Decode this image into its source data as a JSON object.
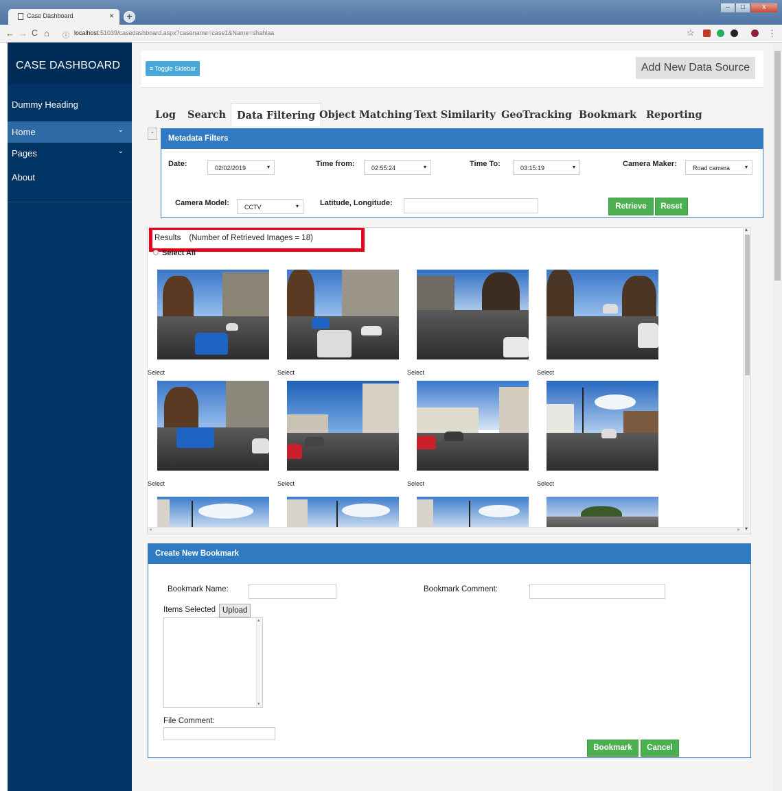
{
  "browser": {
    "tab_title": "Case Dashboard",
    "tab_close": "×",
    "new_tab": "+",
    "url_host": "localhost",
    "url_rest": ":51039/casedashboard.aspx?casename=case1&Name=shahlaa",
    "back": "←",
    "forward": "→",
    "reload": "C",
    "home": "⌂",
    "info": "ⓘ",
    "star": "☆",
    "menu": "⋮",
    "minimize": "–",
    "maximize": "□",
    "close": "x"
  },
  "sidebar": {
    "brand": "CASE DASHBOARD",
    "heading": "Dummy Heading",
    "items": [
      {
        "label": "Home",
        "caret": "⌄"
      },
      {
        "label": "Pages",
        "caret": "⌄"
      }
    ],
    "about": "About"
  },
  "topbar": {
    "toggle_icon": "≡",
    "toggle_label": "Toggle Sidebar",
    "add_source": "Add New Data Source"
  },
  "tabs": [
    "Log",
    "Search",
    "Data Filtering",
    "Object Matching",
    "Text Similarity",
    "GeoTracking",
    "Bookmark",
    "Reporting"
  ],
  "active_tab": "Data Filtering",
  "filters": {
    "collapse": "-",
    "title": "Metadata Filters",
    "date_label": "Date:",
    "date_value": "02/02/2019",
    "time_from_label": "Time from:",
    "time_from_value": "02:55:24",
    "time_to_label": "Time To:",
    "time_to_value": "03:15:19",
    "camera_maker_label": "Camera Maker:",
    "camera_maker_value": "Road camera",
    "camera_model_label": "Camera Model:",
    "camera_model_value": "CCTV",
    "latlon_label": "Latitude, Longitude:",
    "latlon_value": "",
    "dropdown_arrow": "▾",
    "retrieve": "Retrieve",
    "reset": "Reset"
  },
  "results": {
    "label": "Results",
    "count_text": "(Number of Retrieved Images = 18)",
    "select_all": "Select All",
    "select_label": "Select",
    "scroll_up": "▴",
    "scroll_down": "▾",
    "scroll_left": "◂",
    "scroll_right": "▸"
  },
  "bookmark": {
    "title": "Create New Bookmark",
    "name_label": "Bookmark Name:",
    "comment_label": "Bookmark Comment:",
    "items_selected_label": "Items Selected",
    "upload": "Upload",
    "file_comment_label": "File Comment:",
    "bookmark_btn": "Bookmark",
    "cancel_btn": "Cancel",
    "scroll_up": "▴",
    "scroll_down": "▾"
  },
  "colors": {
    "sidebar": "#003464",
    "accent_blue": "#2f7ac0",
    "green_button": "#4caf50",
    "highlight_red": "#e8001c"
  }
}
